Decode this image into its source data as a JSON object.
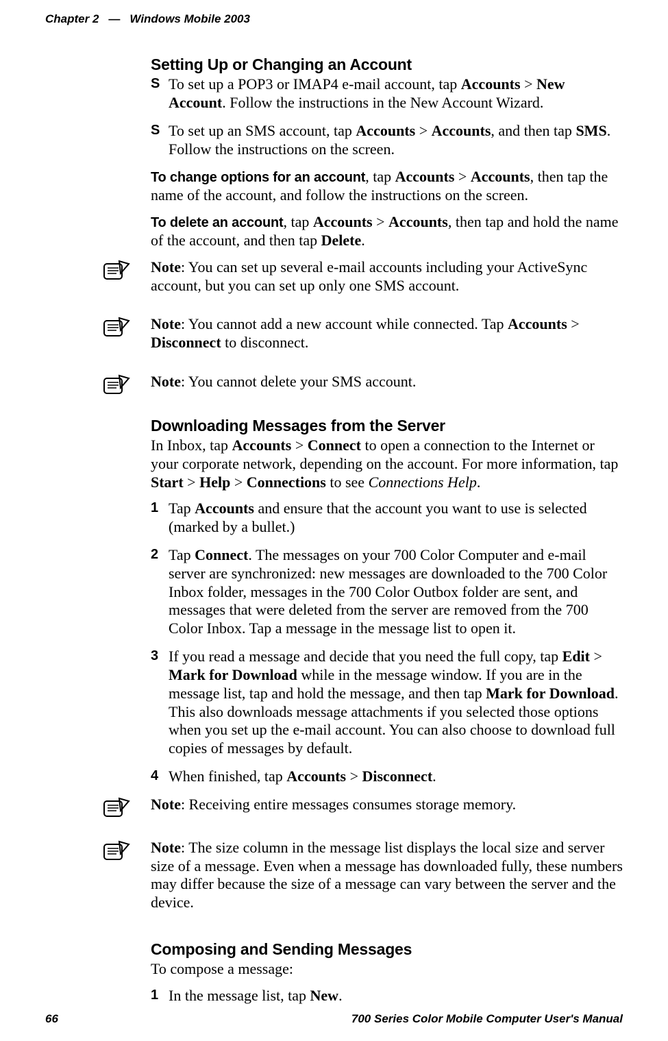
{
  "header": {
    "chapter": "Chapter 2",
    "dash": "—",
    "title": "Windows Mobile 2003"
  },
  "sec1": {
    "heading": "Setting Up or Changing an Account",
    "bul1": {
      "pre": "To set up a POP3 or IMAP4 e-mail account, tap ",
      "b1": "Accounts",
      "mid1": " > ",
      "b2": "New Account",
      "post": ". Follow the instructions in the New Account Wizard."
    },
    "bul2": {
      "pre": "To set up an SMS account, tap ",
      "b1": "Accounts",
      "mid1": " > ",
      "b2": "Accounts",
      "mid2": ", and then tap ",
      "b3": "SMS",
      "post": ". Follow the instructions on the screen."
    },
    "change": {
      "lead": "To change options for an account",
      "t1": ", tap ",
      "b1": "Accounts",
      "t2": " > ",
      "b2": "Accounts",
      "t3": ", then tap the name of the account, and follow the instructions on the screen."
    },
    "delete": {
      "lead": "To delete an account",
      "t1": ", tap ",
      "b1": "Accounts",
      "t2": " > ",
      "b2": "Accounts",
      "t3": ", then tap and hold the name of the account, and then tap ",
      "b3": "Delete",
      "t4": "."
    },
    "note1": {
      "b": "Note",
      "t": ": You can set up several e-mail accounts including your ActiveSync account, but you can set up only one SMS account."
    },
    "note2": {
      "b": "Note",
      "t1": ": You cannot add a new account while connected. Tap ",
      "b1": "Accounts",
      "t2": " > ",
      "b2": "Disconnect",
      "t3": " to disconnect."
    },
    "note3": {
      "b": "Note",
      "t": ": You cannot delete your SMS account."
    }
  },
  "sec2": {
    "heading": "Downloading Messages from the Server",
    "intro": {
      "t1": "In Inbox, tap ",
      "b1": "Accounts",
      "t2": " > ",
      "b2": "Connect",
      "t3": " to open a connection to the Internet or your corporate network, depending on the account. For more information, tap ",
      "b3": "Start",
      "t4": " > ",
      "b4": "Help",
      "t5": " > ",
      "b5": "Connections",
      "t6": " to see ",
      "i1": "Connections Help",
      "t7": "."
    },
    "step1": {
      "t1": "Tap ",
      "b1": "Accounts",
      "t2": " and ensure that the account you want to use is selected (marked by a bullet.)"
    },
    "step2": {
      "t1": "Tap ",
      "b1": "Connect",
      "t2": ". The messages on your 700 Color Computer and e-mail server are synchronized: new messages are downloaded to the 700 Color Inbox folder, messages in the 700 Color Outbox folder are sent, and messages that were deleted from the server are removed from the 700 Color Inbox. Tap a message in the message list to open it."
    },
    "step3": {
      "t1": "If you read a message and decide that you need the full copy, tap ",
      "b1": "Edit",
      "t2": " > ",
      "b2": "Mark for Download",
      "t3": " while in the message window. If you are in the message list, tap and hold the message, and then tap ",
      "b3": "Mark for Download",
      "t4": ". This also downloads message attachments if you selected those options when you set up the e-mail account. You can also choose to download full copies of messages by default."
    },
    "step4": {
      "t1": "When finished, tap ",
      "b1": "Accounts",
      "t2": " > ",
      "b2": "Disconnect",
      "t3": "."
    },
    "note4": {
      "b": "Note",
      "t": ": Receiving entire messages consumes storage memory."
    },
    "note5": {
      "b": "Note",
      "t": ": The size column in the message list displays the local size and server size of a message. Even when a message has downloaded fully, these numbers may differ because the size of a message can vary between the server and the device."
    }
  },
  "sec3": {
    "heading": "Composing and Sending Messages",
    "intro": "To compose a message:",
    "step1": {
      "t1": "In the message list, tap ",
      "b1": "New",
      "t2": "."
    }
  },
  "footer": {
    "page": "66",
    "manual": "700 Series Color Mobile Computer User's Manual"
  }
}
